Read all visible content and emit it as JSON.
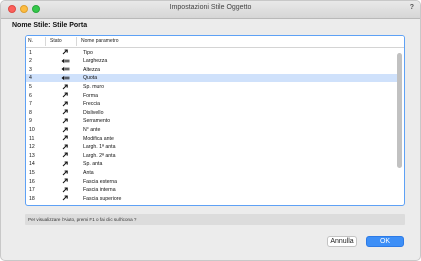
{
  "window": {
    "title": "Impostazioni Stile Oggetto",
    "help_glyph": "?"
  },
  "style": {
    "label": "Nome Stile:",
    "value": "Stile Porta"
  },
  "table": {
    "headers": {
      "n": "N.",
      "stato": "Stato",
      "nome": "Nome parametro"
    },
    "rows": [
      {
        "n": "1",
        "stato_icon": "from-style-icon",
        "nome": "Tipo"
      },
      {
        "n": "2",
        "stato_icon": "by-instance-icon",
        "nome": "Larghezza"
      },
      {
        "n": "3",
        "stato_icon": "by-instance-icon",
        "nome": "Altezza"
      },
      {
        "n": "4",
        "stato_icon": "by-instance-icon",
        "nome": "Quota"
      },
      {
        "n": "5",
        "stato_icon": "from-style-icon",
        "nome": "Sp. muro"
      },
      {
        "n": "6",
        "stato_icon": "from-style-icon",
        "nome": "Forma"
      },
      {
        "n": "7",
        "stato_icon": "from-style-icon",
        "nome": "Freccia"
      },
      {
        "n": "8",
        "stato_icon": "from-style-icon",
        "nome": "Dislivello"
      },
      {
        "n": "9",
        "stato_icon": "from-style-icon",
        "nome": "Serramento"
      },
      {
        "n": "10",
        "stato_icon": "from-style-icon",
        "nome": "N° ante"
      },
      {
        "n": "11",
        "stato_icon": "from-style-icon",
        "nome": "Modifica ante"
      },
      {
        "n": "12",
        "stato_icon": "from-style-icon",
        "nome": "Largh. 1ª anta"
      },
      {
        "n": "13",
        "stato_icon": "from-style-icon",
        "nome": "Largh. 2ª anta"
      },
      {
        "n": "14",
        "stato_icon": "from-style-icon",
        "nome": "Sp. anta"
      },
      {
        "n": "15",
        "stato_icon": "from-style-icon",
        "nome": "Anta"
      },
      {
        "n": "16",
        "stato_icon": "from-style-icon",
        "nome": "Fascia esterna"
      },
      {
        "n": "17",
        "stato_icon": "from-style-icon",
        "nome": "Fascia interna"
      },
      {
        "n": "18",
        "stato_icon": "from-style-icon",
        "nome": "Fascia superiore"
      }
    ],
    "selected_row": 3
  },
  "hint": "Per visualizzare l'Aiuto, premi F1 o fai clic sull'icona ?",
  "buttons": {
    "cancel": "Annulla",
    "ok": "OK"
  },
  "colors": {
    "accent": "#3d8ff7",
    "selection": "#cfe1fb"
  }
}
